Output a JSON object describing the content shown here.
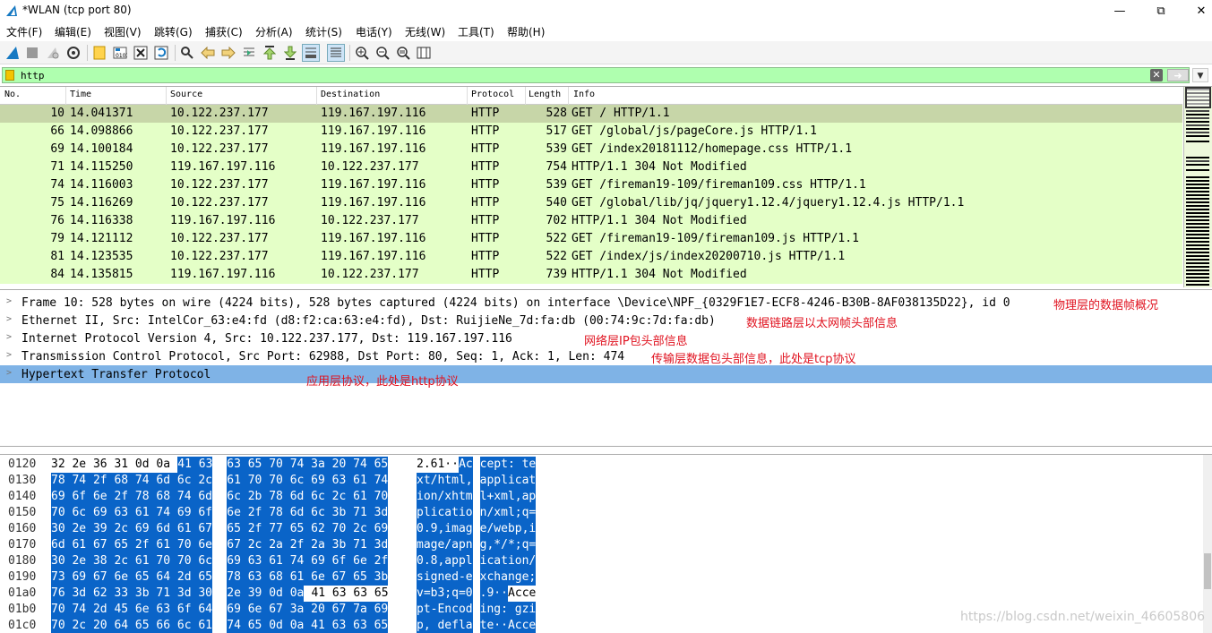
{
  "window": {
    "title": "*WLAN (tcp port 80)",
    "minimize_icon": "minimize-icon",
    "restore_icon": "restore-icon",
    "close_icon": "close-icon"
  },
  "menu": [
    "文件(F)",
    "编辑(E)",
    "视图(V)",
    "跳转(G)",
    "捕获(C)",
    "分析(A)",
    "统计(S)",
    "电话(Y)",
    "无线(W)",
    "工具(T)",
    "帮助(H)"
  ],
  "toolbar_icons": [
    "start-capture-icon",
    "stop-capture-icon",
    "restart-capture-icon",
    "capture-options-icon",
    "open-file-icon",
    "save-file-icon",
    "close-file-icon",
    "reload-file-icon",
    "find-packet-icon",
    "go-back-icon",
    "go-forward-icon",
    "go-to-packet-icon",
    "first-packet-icon",
    "last-packet-icon",
    "autoscroll-icon",
    "colorize-icon",
    "zoom-in-icon",
    "zoom-out-icon",
    "normal-size-icon",
    "resize-columns-icon"
  ],
  "filter": {
    "value": "http",
    "bookmark_icon": "bookmark-icon",
    "clear_icon": "clear-filter-icon",
    "apply_icon": "apply-filter-icon",
    "dropdown_icon": "filter-history-dropdown-icon",
    "color": "#afffaf"
  },
  "packet_list": {
    "columns": [
      "No.",
      "Time",
      "Source",
      "Destination",
      "Protocol",
      "Length",
      "Info"
    ],
    "rows": [
      {
        "no": "10",
        "time": "14.041371",
        "src": "10.122.237.177",
        "dst": "119.167.197.116",
        "proto": "HTTP",
        "len": "528",
        "info": "GET / HTTP/1.1"
      },
      {
        "no": "66",
        "time": "14.098866",
        "src": "10.122.237.177",
        "dst": "119.167.197.116",
        "proto": "HTTP",
        "len": "517",
        "info": "GET /global/js/pageCore.js HTTP/1.1"
      },
      {
        "no": "69",
        "time": "14.100184",
        "src": "10.122.237.177",
        "dst": "119.167.197.116",
        "proto": "HTTP",
        "len": "539",
        "info": "GET /index20181112/homepage.css HTTP/1.1"
      },
      {
        "no": "71",
        "time": "14.115250",
        "src": "119.167.197.116",
        "dst": "10.122.237.177",
        "proto": "HTTP",
        "len": "754",
        "info": "HTTP/1.1 304 Not Modified"
      },
      {
        "no": "74",
        "time": "14.116003",
        "src": "10.122.237.177",
        "dst": "119.167.197.116",
        "proto": "HTTP",
        "len": "539",
        "info": "GET /fireman19-109/fireman109.css HTTP/1.1"
      },
      {
        "no": "75",
        "time": "14.116269",
        "src": "10.122.237.177",
        "dst": "119.167.197.116",
        "proto": "HTTP",
        "len": "540",
        "info": "GET /global/lib/jq/jquery1.12.4/jquery1.12.4.js HTTP/1.1"
      },
      {
        "no": "76",
        "time": "14.116338",
        "src": "119.167.197.116",
        "dst": "10.122.237.177",
        "proto": "HTTP",
        "len": "702",
        "info": "HTTP/1.1 304 Not Modified"
      },
      {
        "no": "79",
        "time": "14.121112",
        "src": "10.122.237.177",
        "dst": "119.167.197.116",
        "proto": "HTTP",
        "len": "522",
        "info": "GET /fireman19-109/fireman109.js HTTP/1.1"
      },
      {
        "no": "81",
        "time": "14.123535",
        "src": "10.122.237.177",
        "dst": "119.167.197.116",
        "proto": "HTTP",
        "len": "522",
        "info": "GET /index/js/index20200710.js HTTP/1.1"
      },
      {
        "no": "84",
        "time": "14.135815",
        "src": "119.167.197.116",
        "dst": "10.122.237.177",
        "proto": "HTTP",
        "len": "739",
        "info": "HTTP/1.1 304 Not Modified"
      }
    ],
    "row_color": "#e4ffc7",
    "selected_row_color": "#c7d6a8"
  },
  "details": {
    "rows": [
      {
        "text": "Frame 10: 528 bytes on wire (4224 bits), 528 bytes captured (4224 bits) on interface \\Device\\NPF_{0329F1E7-ECF8-4246-B30B-8AF038135D22}, id 0",
        "annotation": "物理层的数据帧概况"
      },
      {
        "text": "Ethernet II, Src: IntelCor_63:e4:fd (d8:f2:ca:63:e4:fd), Dst: RuijieNe_7d:fa:db (00:74:9c:7d:fa:db)",
        "annotation": "数据链路层以太网帧头部信息"
      },
      {
        "text": "Internet Protocol Version 4, Src: 10.122.237.177, Dst: 119.167.197.116",
        "annotation": "网络层IP包头部信息"
      },
      {
        "text": "Transmission Control Protocol, Src Port: 62988, Dst Port: 80, Seq: 1, Ack: 1, Len: 474",
        "annotation": "传输层数据包头部信息，此处是tcp协议"
      },
      {
        "text": "Hypertext Transfer Protocol",
        "annotation": "应用层协议，此处是http协议"
      }
    ],
    "annotation_color": "#e0121f",
    "selected_color": "#7fb3e6"
  },
  "bytes": {
    "rows": [
      {
        "off": "0120",
        "hex": [
          "32 2e 36 31 0d 0a",
          "41 63",
          "63 65 70 74 3a 20 74 65"
        ],
        "asc": [
          "2.61··",
          "Ac",
          "cept: te"
        ]
      },
      {
        "off": "0130",
        "hex": [
          "78 74 2f 68 74 6d 6c 2c",
          "61 70 70 6c 69 63 61 74"
        ],
        "asc": [
          "xt/html,",
          "applicat"
        ]
      },
      {
        "off": "0140",
        "hex": [
          "69 6f 6e 2f 78 68 74 6d",
          "6c 2b 78 6d 6c 2c 61 70"
        ],
        "asc": [
          "ion/xhtm",
          "l+xml,ap"
        ]
      },
      {
        "off": "0150",
        "hex": [
          "70 6c 69 63 61 74 69 6f",
          "6e 2f 78 6d 6c 3b 71 3d"
        ],
        "asc": [
          "plicatio",
          "n/xml;q="
        ]
      },
      {
        "off": "0160",
        "hex": [
          "30 2e 39 2c 69 6d 61 67",
          "65 2f 77 65 62 70 2c 69"
        ],
        "asc": [
          "0.9,imag",
          "e/webp,i"
        ]
      },
      {
        "off": "0170",
        "hex": [
          "6d 61 67 65 2f 61 70 6e",
          "67 2c 2a 2f 2a 3b 71 3d"
        ],
        "asc": [
          "mage/apn",
          "g,*/*;q="
        ]
      },
      {
        "off": "0180",
        "hex": [
          "30 2e 38 2c 61 70 70 6c",
          "69 63 61 74 69 6f 6e 2f"
        ],
        "asc": [
          "0.8,appl",
          "ication/"
        ]
      },
      {
        "off": "0190",
        "hex": [
          "73 69 67 6e 65 64 2d 65",
          "78 63 68 61 6e 67 65 3b"
        ],
        "asc": [
          "signed-e",
          "xchange;"
        ]
      },
      {
        "off": "01a0",
        "hex": [
          "76 3d 62 33 3b 71 3d 30",
          "2e 39 0d 0a",
          "41 63 63 65"
        ],
        "asc": [
          "v=b3;q=0",
          ".9··",
          "Acce"
        ]
      },
      {
        "off": "01b0",
        "hex": [
          "70 74 2d 45 6e 63 6f 64",
          "69 6e 67 3a 20 67 7a 69"
        ],
        "asc": [
          "pt-Encod",
          "ing: gzi"
        ]
      },
      {
        "off": "01c0",
        "hex": [
          "70 2c 20 64 65 66 6c 61",
          "74 65 0d 0a 41 63 63 65"
        ],
        "asc": [
          "p, defla",
          "te··Acce"
        ]
      }
    ],
    "highlight_color": "#0a64c8"
  },
  "watermark": "https://blog.csdn.net/weixin_46605806"
}
